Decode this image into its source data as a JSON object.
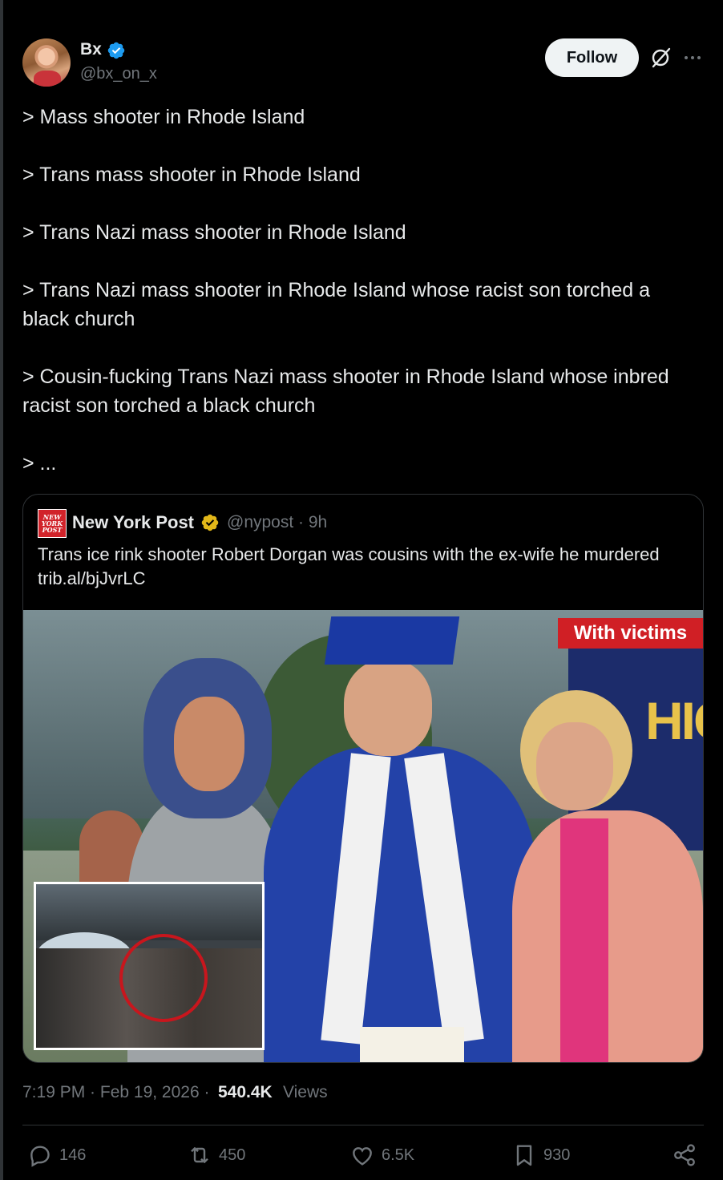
{
  "author": {
    "display_name": "Bx",
    "handle": "@bx_on_x",
    "follow_label": "Follow"
  },
  "tweet": {
    "lines": [
      "> Mass shooter in Rhode Island",
      "> Trans mass shooter in Rhode Island",
      "> Trans Nazi mass shooter in Rhode Island",
      "> Trans Nazi mass shooter in Rhode Island whose racist son torched a",
      "black church",
      "> Cousin-fucking Trans Nazi mass shooter in Rhode Island whose inbred",
      "racist son torched a black church",
      "> ..."
    ]
  },
  "quote": {
    "logo_lines": [
      "NEW",
      "YORK",
      "POST"
    ],
    "name": "New York Post",
    "handle_time": "@nypost · 9h",
    "text": "Trans ice rink shooter Robert Dorgan was cousins with the ex-wife he murdered trib.al/bjJvrLC",
    "image": {
      "label": "With victims",
      "banner_text": "HIG"
    }
  },
  "meta": {
    "timestamp": "7:19 PM · Feb 19, 2026 · ",
    "views_count": "540.4K",
    "views_label": "Views"
  },
  "actions": {
    "replies": "146",
    "reposts": "450",
    "likes": "6.5K",
    "bookmarks": "930"
  },
  "colors": {
    "background": "#000000",
    "text": "#e7e9ea",
    "muted": "#71767b",
    "verified_blue": "#1d9bf0",
    "verified_gold": "#e2b719",
    "label_red": "#d01f25"
  }
}
